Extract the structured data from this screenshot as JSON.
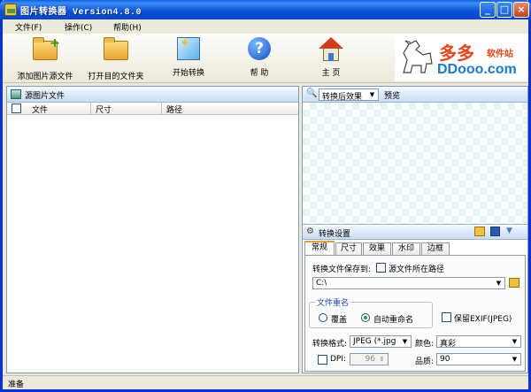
{
  "window": {
    "title": "图片转换器 Version4.8.0"
  },
  "menu": [
    "文件(F)",
    "操作(C)",
    "帮助(H)"
  ],
  "toolbar": {
    "add_source": "添加图片源文件",
    "open_target": "打开目的文件夹",
    "start": "开始转换",
    "help": "帮 助",
    "home": "主 页"
  },
  "logo": {
    "cn": "多多",
    "small": "软件站",
    "en": "DDooo.com"
  },
  "source_panel": {
    "title": "源图片文件",
    "columns": [
      "文件",
      "尺寸",
      "路径"
    ]
  },
  "preview": {
    "mode": "转换后效果",
    "label": "预览"
  },
  "settings": {
    "title": "转换设置",
    "tabs": [
      "常规",
      "尺寸",
      "效果",
      "水印",
      "边框"
    ],
    "save_to_label": "转换文件保存到:",
    "same_path_label": "源文件所在路径",
    "path_value": "C:\\",
    "rename_group": "文件重名",
    "overwrite": "覆盖",
    "auto_rename": "自动重命名",
    "keep_exif": "保留EXIF(JPEG)",
    "format_label": "转换格式:",
    "format_value": "JPEG (*.jpg",
    "color_label": "颜色:",
    "color_value": "真彩",
    "dpi_label": "DPI:",
    "dpi_value": "96",
    "quality_label": "品质:",
    "quality_value": "90"
  },
  "status": "准备"
}
